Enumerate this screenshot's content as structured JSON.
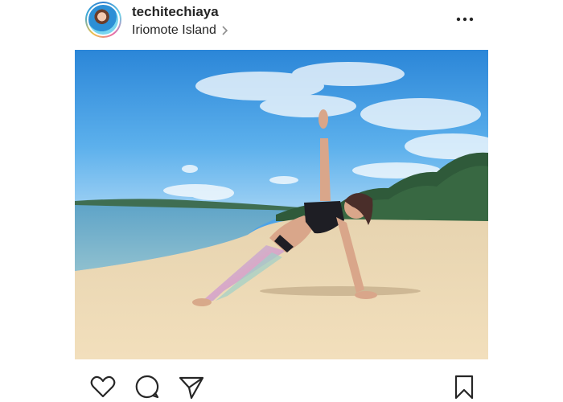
{
  "post": {
    "username": "techitechiaya",
    "location": "Iriomote Island"
  },
  "icons": {
    "avatar": "profile-photo",
    "location_chevron": "chevron-right-icon",
    "more": "more-options-icon",
    "like": "heart-icon",
    "comment": "speech-bubble-icon",
    "share": "paper-plane-icon",
    "save": "bookmark-icon"
  },
  "colors": {
    "text": "#262626",
    "background": "#ffffff",
    "icon_stroke": "#262626"
  }
}
